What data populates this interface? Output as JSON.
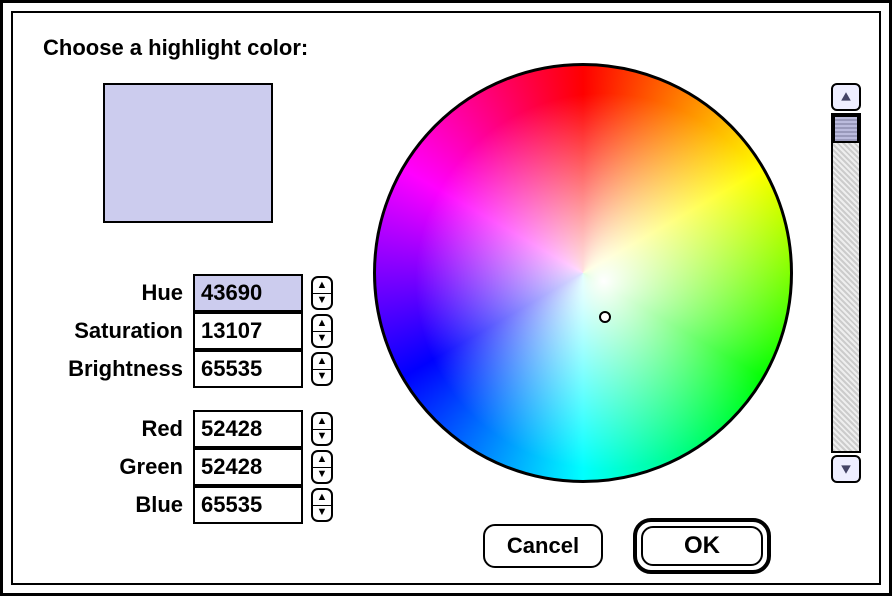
{
  "title": "Choose a highlight color:",
  "swatch_color": "#ccccee",
  "hsb": {
    "hue": {
      "label": "Hue",
      "value": "43690",
      "selected": true
    },
    "saturation": {
      "label": "Saturation",
      "value": "13107",
      "selected": false
    },
    "brightness": {
      "label": "Brightness",
      "value": "65535",
      "selected": false
    }
  },
  "rgb": {
    "red": {
      "label": "Red",
      "value": "52428"
    },
    "green": {
      "label": "Green",
      "value": "52428"
    },
    "blue": {
      "label": "Blue",
      "value": "65535"
    }
  },
  "buttons": {
    "cancel": "Cancel",
    "ok": "OK"
  }
}
